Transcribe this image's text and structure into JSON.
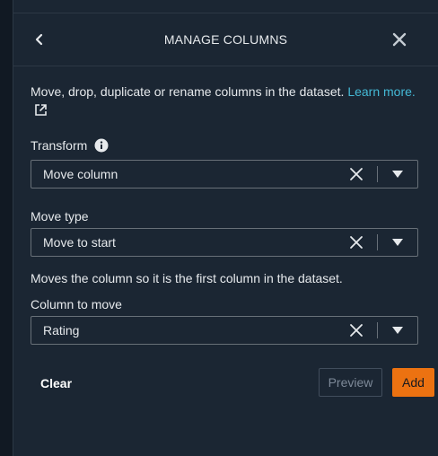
{
  "header": {
    "title": "MANAGE COLUMNS",
    "back_icon": "chevron-left-icon",
    "close_icon": "close-icon"
  },
  "description": {
    "text": "Move, drop, duplicate or rename columns in the dataset.",
    "link_text": "Learn more.",
    "link_icon": "external-link-icon"
  },
  "transform": {
    "label": "Transform",
    "info_icon": "info-icon",
    "value": "Move column"
  },
  "move_type": {
    "label": "Move type",
    "value": "Move to start",
    "hint": "Moves the column so it is the first column in the dataset."
  },
  "column_to_move": {
    "label": "Column to move",
    "value": "Rating"
  },
  "footer": {
    "clear_label": "Clear",
    "preview_label": "Preview",
    "add_label": "Add"
  },
  "colors": {
    "background": "#1b2633",
    "link": "#44b9d6",
    "primary_button": "#ec7211",
    "border": "#687078"
  }
}
